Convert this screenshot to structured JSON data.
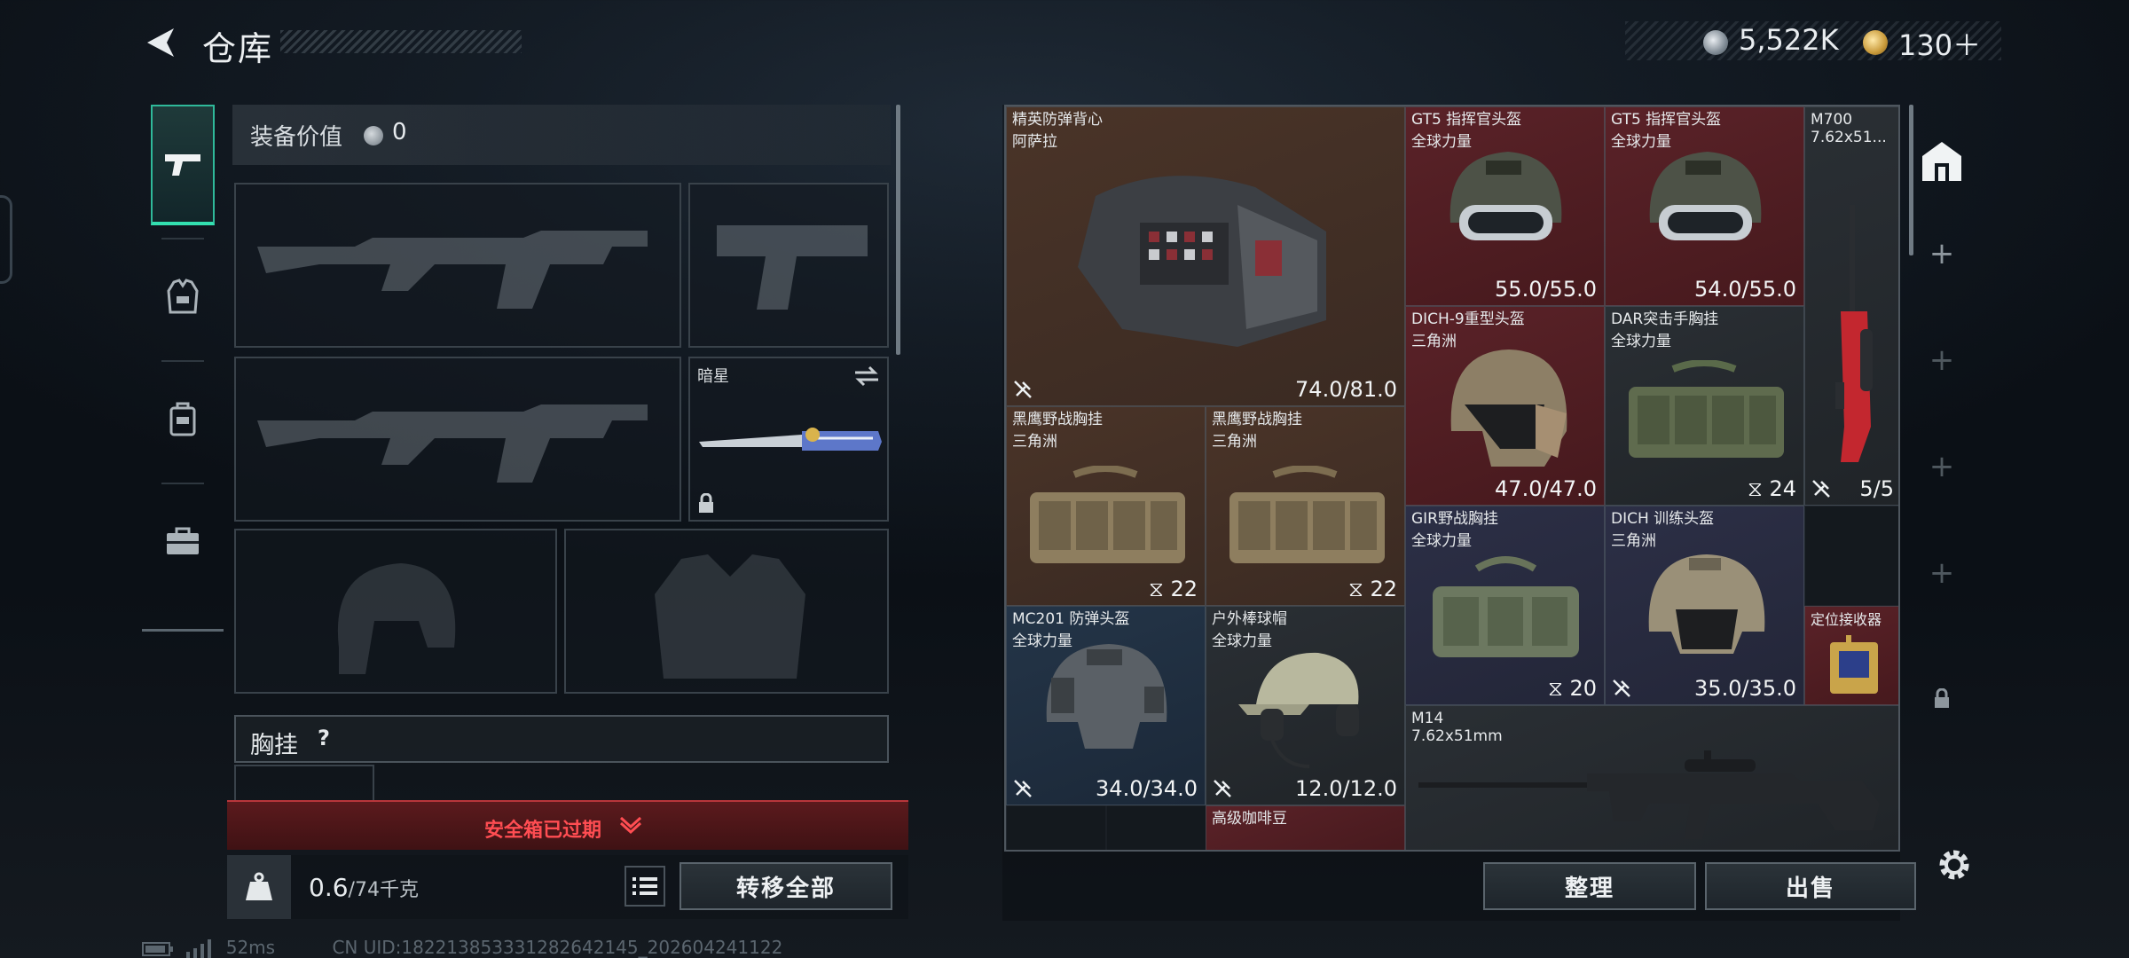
{
  "header": {
    "title": "仓库",
    "back_icon": "back-arrow-icon"
  },
  "currency": {
    "silver": "5,522K",
    "gold": "130＋",
    "silver_icon": "silver-coin-icon",
    "gold_icon": "gold-coin-icon"
  },
  "left_tabs": [
    {
      "icon": "pistol-icon",
      "active": true
    },
    {
      "icon": "vest-icon"
    },
    {
      "icon": "backpack-icon"
    },
    {
      "icon": "briefcase-icon"
    }
  ],
  "equipment": {
    "value_label": "装备价值",
    "value": "0",
    "knife_slot_label": "暗星",
    "chest_label": "胸挂",
    "chest_help": "?"
  },
  "safebox": {
    "expired_text": "安全箱已过期"
  },
  "weight": {
    "current": "0.6",
    "max": "/74千克"
  },
  "buttons": {
    "transfer_all": "转移全部",
    "organize": "整理",
    "sell": "出售"
  },
  "stash_items": [
    {
      "name": "精英防弹背心",
      "sub": "阿萨拉",
      "durability": "74.0/81.0"
    },
    {
      "name": "GT5 指挥官头盔",
      "sub": "全球力量",
      "durability": "55.0/55.0"
    },
    {
      "name": "GT5 指挥官头盔",
      "sub": "全球力量",
      "durability": "54.0/55.0"
    },
    {
      "name": "M700",
      "sub": "7.62x51...",
      "count": "5/5"
    },
    {
      "name": "DICH-9重型头盔",
      "sub": "三角洲",
      "durability": "47.0/47.0"
    },
    {
      "name": "DAR突击手胸挂",
      "sub": "全球力量",
      "count": "24"
    },
    {
      "name": "黑鹰野战胸挂",
      "sub": "三角洲",
      "count": "22"
    },
    {
      "name": "黑鹰野战胸挂",
      "sub": "三角洲",
      "count": "22"
    },
    {
      "name": "GIR野战胸挂",
      "sub": "全球力量",
      "count": "20"
    },
    {
      "name": "DICH 训练头盔",
      "sub": "三角洲",
      "durability": "35.0/35.0"
    },
    {
      "name": "定位接收器",
      "sub": ""
    },
    {
      "name": "MC201 防弹头盔",
      "sub": "全球力量",
      "durability": "34.0/34.0"
    },
    {
      "name": "户外棒球帽",
      "sub": "全球力量",
      "durability": "12.0/12.0"
    },
    {
      "name": "M14",
      "sub": "7.62x51mm"
    },
    {
      "name": "高级咖啡豆",
      "sub": ""
    }
  ],
  "status_bar": {
    "ping": "52ms",
    "uid": "CN UID:1822138533312826421​45_202604241122"
  },
  "colors": {
    "accent": "#33e0b0",
    "warning": "#ff4d52",
    "rarity_red": "#5a2228",
    "rarity_brown": "#4a3428"
  }
}
